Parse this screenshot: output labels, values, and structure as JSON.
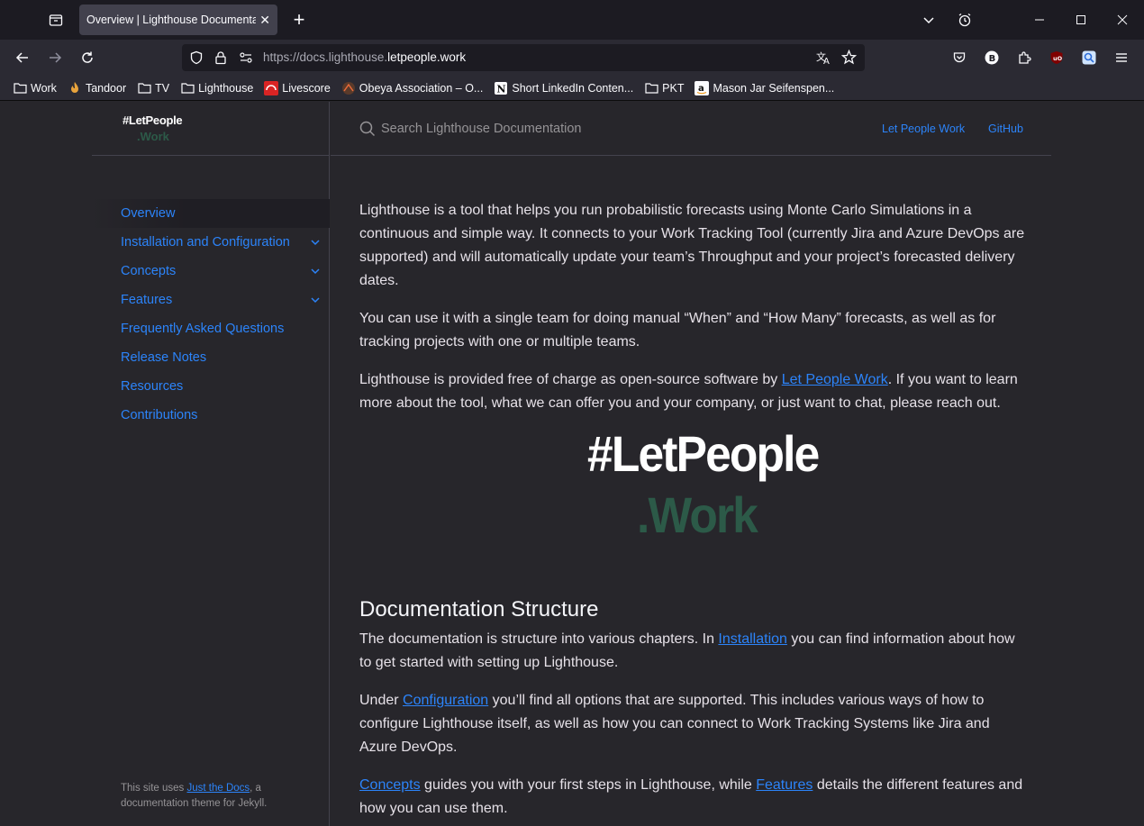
{
  "browser": {
    "tab_title": "Overview | Lighthouse Documentation",
    "url_prefix": "https://docs.lighthouse.",
    "url_domain": "letpeople.work",
    "bookmarks": [
      {
        "label": "Work",
        "icon": "folder-icon"
      },
      {
        "label": "Tandoor",
        "icon": "tandoor-icon"
      },
      {
        "label": "TV",
        "icon": "folder-icon"
      },
      {
        "label": "Lighthouse",
        "icon": "folder-icon"
      },
      {
        "label": "Livescore",
        "icon": "livescore-icon"
      },
      {
        "label": "Obeya Association – O...",
        "icon": "obeya-icon"
      },
      {
        "label": "Short LinkedIn Conten...",
        "icon": "notion-icon"
      },
      {
        "label": "PKT",
        "icon": "folder-icon"
      },
      {
        "label": "Mason Jar Seifenspen...",
        "icon": "amazon-icon"
      }
    ]
  },
  "sidebar": {
    "logo_line1": "#LetPeople",
    "logo_line2": ".Work",
    "items": [
      {
        "label": "Overview",
        "active": true,
        "expandable": false
      },
      {
        "label": "Installation and Configuration",
        "active": false,
        "expandable": true
      },
      {
        "label": "Concepts",
        "active": false,
        "expandable": true
      },
      {
        "label": "Features",
        "active": false,
        "expandable": true
      },
      {
        "label": "Frequently Asked Questions",
        "active": false,
        "expandable": false
      },
      {
        "label": "Release Notes",
        "active": false,
        "expandable": false
      },
      {
        "label": "Resources",
        "active": false,
        "expandable": false
      },
      {
        "label": "Contributions",
        "active": false,
        "expandable": false
      }
    ],
    "footer_prefix": "This site uses ",
    "footer_link": "Just the Docs",
    "footer_suffix": ", a documentation theme for Jekyll."
  },
  "header": {
    "search_placeholder": "Search Lighthouse Documentation",
    "aux_links": [
      "Let People Work",
      "GitHub"
    ]
  },
  "main": {
    "p1": "Lighthouse is a tool that helps you run probabilistic forecasts using Monte Carlo Simulations in a continuous and simple way. It connects to your Work Tracking Tool (currently Jira and Azure DevOps are supported) and will automatically update your team’s Throughput and your project’s forecasted delivery dates.",
    "p2": "You can use it with a single team for doing manual “When” and “How Many” forecasts, as well as for tracking projects with one or multiple teams.",
    "p3_before": "Lighthouse is provided free of charge as open-source software by ",
    "p3_link": "Let People Work",
    "p3_after": ". If you want to learn more about the tool, what we can offer you and your company, or just want to chat, please reach out.",
    "logo_line1": "#LetPeople",
    "logo_line2": ".Work",
    "h2": "Documentation Structure",
    "p4_before": "The documentation is structure into various chapters. In ",
    "p4_link": "Installation",
    "p4_after": " you can find information about how to get started with setting up Lighthouse.",
    "p5_before": "Under ",
    "p5_link": "Configuration",
    "p5_after": " you’ll find all options that are supported. This includes various ways of how to configure Lighthouse itself, as well as how you can connect to Work Tracking Systems like Jira and Azure DevOps.",
    "p6_link1": "Concepts",
    "p6_mid": " guides you with your first steps in Lighthouse, while ",
    "p6_link2": "Features",
    "p6_after": " details the different features and how you can use them."
  }
}
